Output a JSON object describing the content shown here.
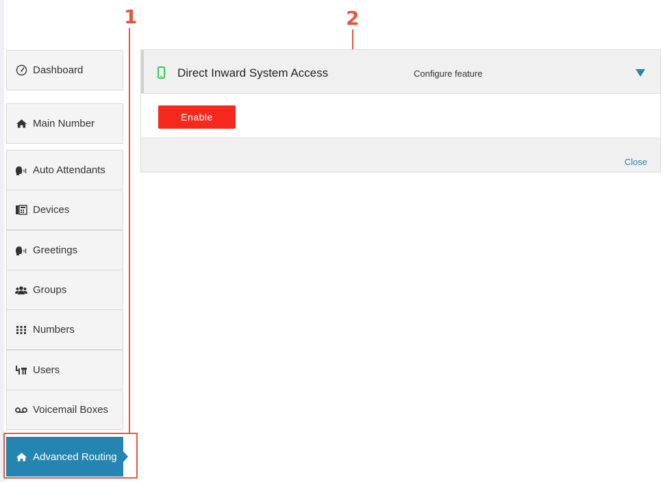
{
  "annotations": {
    "marker_1": "1",
    "marker_2": "2"
  },
  "sidebar": {
    "items": [
      {
        "label": "Dashboard",
        "icon": "gauge-icon"
      },
      {
        "label": "Main Number",
        "icon": "home-icon"
      },
      {
        "label": "Auto Attendants",
        "icon": "speaking-head-icon"
      },
      {
        "label": "Devices",
        "icon": "fax-device-icon"
      },
      {
        "label": "Greetings",
        "icon": "speaking-head-icon"
      },
      {
        "label": "Groups",
        "icon": "users-group-icon"
      },
      {
        "label": "Numbers",
        "icon": "keypad-icon"
      },
      {
        "label": "Users",
        "icon": "org-chart-icon"
      },
      {
        "label": "Voicemail Boxes",
        "icon": "voicemail-icon"
      },
      {
        "label": "Advanced Routing",
        "icon": "home-icon",
        "active": true
      }
    ]
  },
  "panel": {
    "title": "Direct Inward System Access",
    "configure_label": "Configure feature",
    "enable_label": "Enable",
    "close_label": "Close"
  },
  "colors": {
    "accent": "#2385b0",
    "enable_button": "#f5281e",
    "annotation": "#e8553b",
    "phone_icon": "#37c85a"
  }
}
